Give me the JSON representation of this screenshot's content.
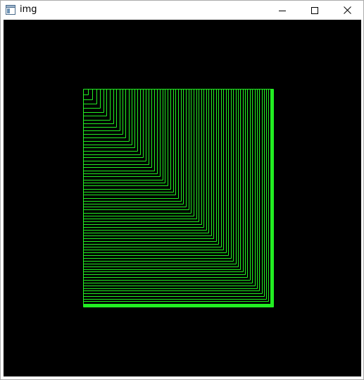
{
  "window": {
    "title": "img",
    "icon": "window-app-icon"
  },
  "controls": {
    "minimize_icon": "minimize-icon",
    "maximize_icon": "maximize-icon",
    "close_icon": "close-icon"
  },
  "canvas": {
    "background_color": "#000000",
    "line_color": "#22ee22",
    "description_icon": "nested-squares-pattern"
  }
}
